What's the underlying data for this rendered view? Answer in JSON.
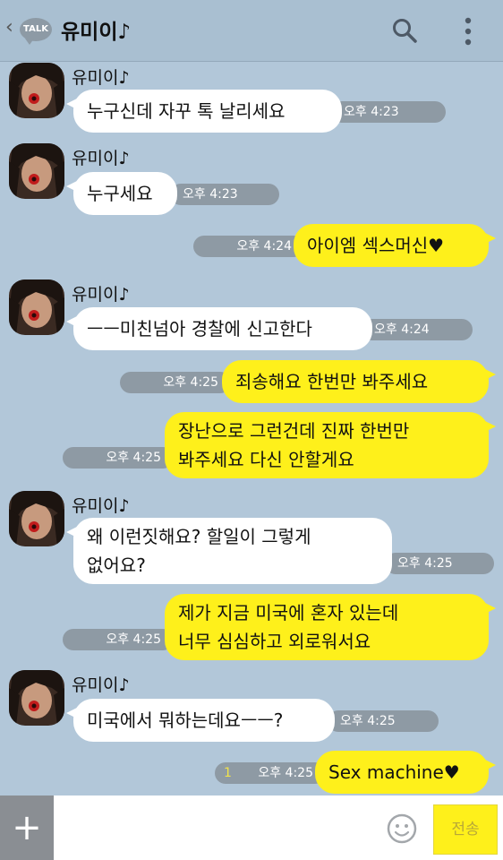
{
  "header": {
    "back_glyph": "‹",
    "badge": "TALK",
    "title": "유미이♪"
  },
  "messages": [
    {
      "sender": "유미이♪",
      "text": "누구신데 자꾸 톡 날리세요",
      "time": "오후 4:23"
    },
    {
      "sender": "유미이♪",
      "text": "누구세요",
      "time": "오후 4:23"
    },
    {
      "text": "아이엠 섹스머신♥",
      "time": "오후 4:24"
    },
    {
      "sender": "유미이♪",
      "text": "ㅡㅡ미친넘아 경찰에 신고한다",
      "time": "오후 4:24"
    },
    {
      "text": "죄송해요 한번만 봐주세요",
      "time": "오후 4:25"
    },
    {
      "text": "장난으로 그런건데 진짜 한번만\n봐주세요 다신 안할게요",
      "time": "오후 4:25"
    },
    {
      "sender": "유미이♪",
      "text": "왜 이런짓해요? 할일이 그렇게\n없어요?",
      "time": "오후 4:25"
    },
    {
      "text": "제가 지금 미국에 혼자 있는데\n너무 심심하고 외로워서요",
      "time": "오후 4:25"
    },
    {
      "sender": "유미이♪",
      "text": "미국에서 뭐하는데요ㅡㅡ?",
      "time": "오후 4:25"
    },
    {
      "text": "Sex machine♥",
      "time": "오후 4:25",
      "unread": "1"
    }
  ],
  "input": {
    "plus_glyph": "+",
    "send_label": "전송",
    "placeholder": ""
  },
  "colors": {
    "background": "#b2c7d9",
    "out_bubble": "#fef01b",
    "in_bubble": "#ffffff",
    "time_pill": "#8e9aa4"
  },
  "icons": [
    "back-icon",
    "talk-icon",
    "search-icon",
    "more-icon",
    "plus-icon",
    "emoji-icon"
  ]
}
